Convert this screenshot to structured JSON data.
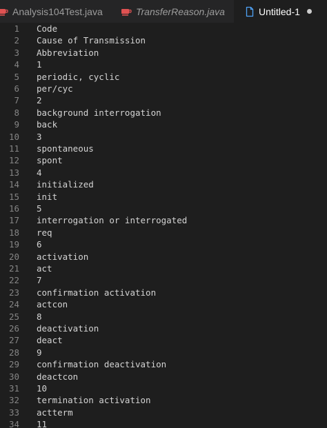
{
  "tabs": [
    {
      "label": "Analysis104Test.java",
      "icon": "java-cup-icon",
      "active": false,
      "italic": false
    },
    {
      "label": "TransferReason.java",
      "icon": "java-cup-icon",
      "active": false,
      "italic": true
    },
    {
      "label": "Untitled-1",
      "icon": "file-icon",
      "active": true,
      "italic": false,
      "unsaved": true
    }
  ],
  "colors": {
    "java_icon": "#e05252",
    "file_icon": "#4fa3f7"
  },
  "lines": [
    {
      "n": "1",
      "text": "Code"
    },
    {
      "n": "2",
      "text": "Cause of Transmission"
    },
    {
      "n": "3",
      "text": "Abbreviation"
    },
    {
      "n": "4",
      "text": "1"
    },
    {
      "n": "5",
      "text": "periodic, cyclic"
    },
    {
      "n": "6",
      "text": "per/cyc"
    },
    {
      "n": "7",
      "text": "2"
    },
    {
      "n": "8",
      "text": "background interrogation"
    },
    {
      "n": "9",
      "text": "back"
    },
    {
      "n": "10",
      "text": "3"
    },
    {
      "n": "11",
      "text": "spontaneous"
    },
    {
      "n": "12",
      "text": "spont"
    },
    {
      "n": "13",
      "text": "4"
    },
    {
      "n": "14",
      "text": "initialized"
    },
    {
      "n": "15",
      "text": "init"
    },
    {
      "n": "16",
      "text": "5"
    },
    {
      "n": "17",
      "text": "interrogation or interrogated"
    },
    {
      "n": "18",
      "text": "req"
    },
    {
      "n": "19",
      "text": "6"
    },
    {
      "n": "20",
      "text": "activation"
    },
    {
      "n": "21",
      "text": "act"
    },
    {
      "n": "22",
      "text": "7"
    },
    {
      "n": "23",
      "text": "confirmation activation"
    },
    {
      "n": "24",
      "text": "actcon"
    },
    {
      "n": "25",
      "text": "8"
    },
    {
      "n": "26",
      "text": "deactivation"
    },
    {
      "n": "27",
      "text": "deact"
    },
    {
      "n": "28",
      "text": "9"
    },
    {
      "n": "29",
      "text": "confirmation deactivation"
    },
    {
      "n": "30",
      "text": "deactcon"
    },
    {
      "n": "31",
      "text": "10"
    },
    {
      "n": "32",
      "text": "termination activation"
    },
    {
      "n": "33",
      "text": "actterm"
    },
    {
      "n": "34",
      "text": "11"
    }
  ]
}
